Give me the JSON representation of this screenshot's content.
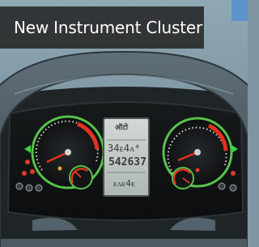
{
  "banner": {
    "title": "New Instrument Cluster"
  },
  "cluster": {
    "display": {
      "brand": "ऑटो",
      "readout_top": "34ᴇ4ᴧ⁴",
      "odometer": "542637",
      "readout_bottom": "ᴇᴧᴇ4ᴇ"
    }
  },
  "colors": {
    "dial_ring": "#57c14a",
    "needle": "#e0321e",
    "indicator_green": "#3fd140",
    "indicator_red": "#e23b2a",
    "lcd_background": "#c6cdca"
  }
}
